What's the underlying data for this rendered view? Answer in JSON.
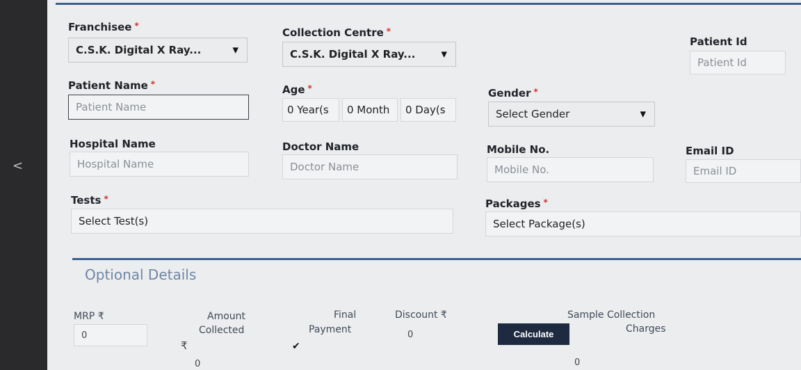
{
  "nav": {
    "back_glyph": "<"
  },
  "form": {
    "franchisee": {
      "label": "Franchisee",
      "req": "*",
      "value": "C.S.K. Digital X Ray..."
    },
    "collection_centre": {
      "label": "Collection Centre",
      "req": "*",
      "value": "C.S.K. Digital X Ray..."
    },
    "patient_id": {
      "label": "Patient Id",
      "placeholder": "Patient Id"
    },
    "patient_name": {
      "label": "Patient Name",
      "req": "*",
      "placeholder": "Patient Name"
    },
    "age": {
      "label": "Age",
      "req": "*",
      "years": "0 Year(s",
      "months": "0 Month",
      "days": "0 Day(s"
    },
    "gender": {
      "label": "Gender",
      "req": "*",
      "value": "Select Gender"
    },
    "hospital_name": {
      "label": "Hospital Name",
      "placeholder": "Hospital Name"
    },
    "doctor_name": {
      "label": "Doctor Name",
      "placeholder": "Doctor Name"
    },
    "mobile": {
      "label": "Mobile No.",
      "placeholder": "Mobile No."
    },
    "email": {
      "label": "Email ID",
      "placeholder": "Email ID"
    },
    "tests": {
      "label": "Tests",
      "req": "*",
      "value": "Select Test(s)"
    },
    "packages": {
      "label": "Packages",
      "req": "*",
      "value": "Select Package(s)"
    }
  },
  "optional": {
    "title": "Optional Details",
    "mrp": {
      "label": "MRP ₹",
      "value": "0"
    },
    "amount_collected": {
      "label_1": "Amount",
      "label_2": "Collected",
      "rupee": "₹",
      "value": "0"
    },
    "final_payment": {
      "label_1": "Final",
      "label_2": "Payment",
      "check": "✔"
    },
    "discount": {
      "label": "Discount ₹",
      "value": "0"
    },
    "calculate_label": "Calculate",
    "sample_collection": {
      "label_1": "Sample Collection",
      "label_2": "Charges",
      "value": "0"
    }
  },
  "colors": {
    "accent_line": "#3b5f8f",
    "button_bg": "#1d2a40",
    "required": "#d0302a"
  }
}
